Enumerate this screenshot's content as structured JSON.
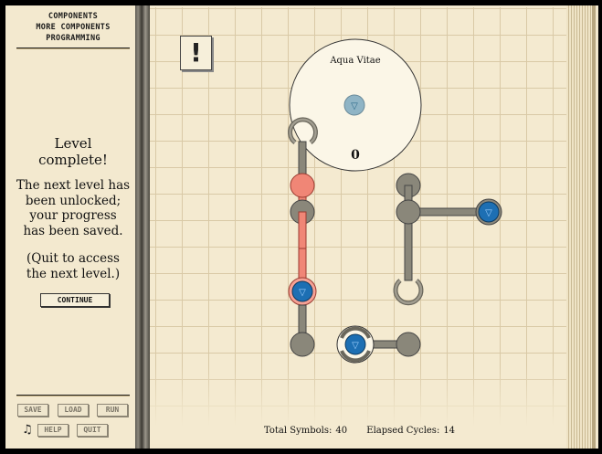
{
  "menu": {
    "items": [
      "COMPONENTS",
      "MORE COMPONENTS",
      "PROGRAMMING"
    ]
  },
  "message": {
    "title_line1": "Level",
    "title_line2": "complete!",
    "body_line1": "The next level has",
    "body_line2": "been unlocked;",
    "body_line3": "your progress",
    "body_line4": "has been saved.",
    "note_line1": "(Quit to access",
    "note_line2": "the next level.)"
  },
  "buttons": {
    "continue": "CONTINUE",
    "save": "SAVE",
    "load": "LOAD",
    "run": "RUN",
    "help": "HELP",
    "quit": "QUIT"
  },
  "music_icon": "♫",
  "warning_icon": "!",
  "reservoir": {
    "label": "Aqua Vitae",
    "count": "0"
  },
  "symbol_glyph": "▽",
  "stats": {
    "total_symbols_label": "Total Symbols:",
    "total_symbols": "40",
    "elapsed_cycles_label": "Elapsed Cycles:",
    "elapsed_cycles": "14"
  },
  "colors": {
    "paper": "#f4ead0",
    "grid": "#d9c9a6",
    "arm_grey": "#8a877a",
    "arm_red": "#f08676",
    "symbol_blue": "#1d6fb3"
  }
}
